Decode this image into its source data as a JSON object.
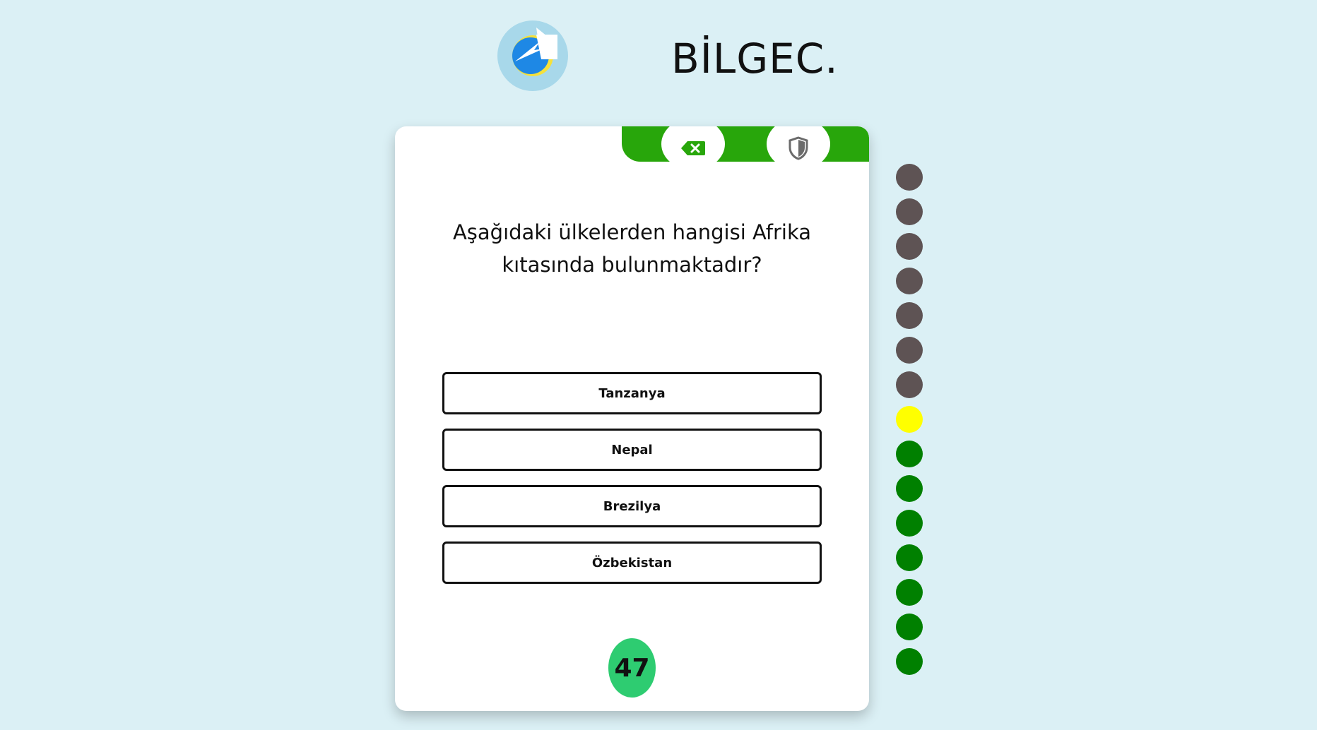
{
  "header": {
    "brand": "BİLGEC."
  },
  "jokers": [
    {
      "icon": "backspace-x-icon"
    },
    {
      "icon": "shield-icon"
    }
  ],
  "question": {
    "text": "Aşağıdaki ülkelerden hangisi Afrika kıtasında bulunmaktadır?"
  },
  "options": [
    {
      "label": "Tanzanya"
    },
    {
      "label": "Nepal"
    },
    {
      "label": "Brezilya"
    },
    {
      "label": "Özbekistan"
    }
  ],
  "timer": {
    "value": "47"
  },
  "progress": {
    "colors": {
      "upcoming": "#5e5354",
      "current": "#ffff00",
      "completed": "#008000"
    },
    "states": [
      "upcoming",
      "upcoming",
      "upcoming",
      "upcoming",
      "upcoming",
      "upcoming",
      "upcoming",
      "current",
      "completed",
      "completed",
      "completed",
      "completed",
      "completed",
      "completed",
      "completed"
    ]
  },
  "theme": {
    "background": "#dbf0f5",
    "joker_bar": "#28a60b",
    "timer_bg": "#2ecc71"
  }
}
